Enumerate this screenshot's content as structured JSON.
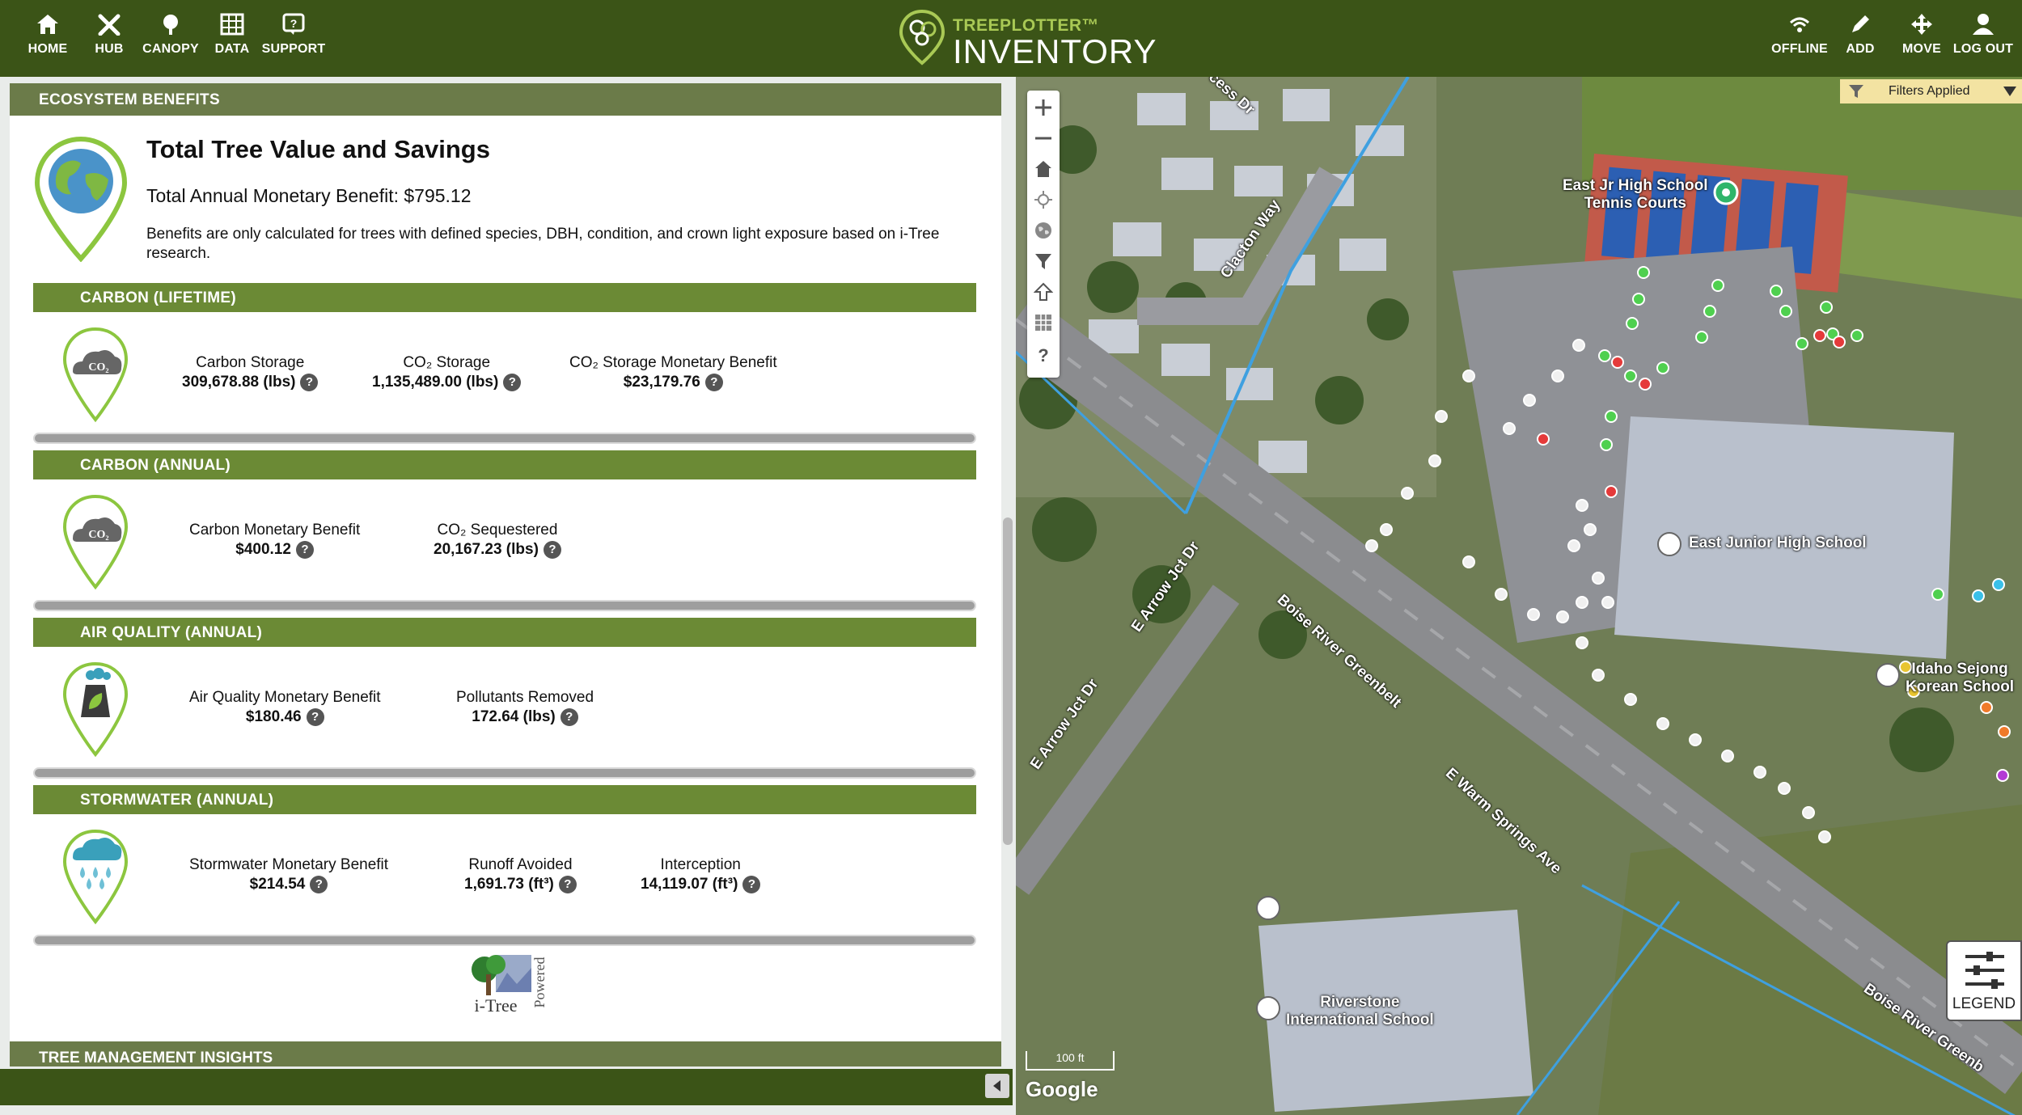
{
  "nav": {
    "home": "HOME",
    "hub": "HUB",
    "canopy": "CANOPY",
    "data": "DATA",
    "support": "SUPPORT",
    "offline": "OFFLINE",
    "add": "ADD",
    "move": "MOVE",
    "logout": "LOG OUT"
  },
  "logo": {
    "small": "TREEPLOTTER™",
    "big": "INVENTORY"
  },
  "panel": {
    "section_title": "ECOSYSTEM BENEFITS",
    "totals": {
      "title": "Total Tree Value and Savings",
      "annual": "Total Annual Monetary Benefit: $795.12",
      "note": "Benefits are only calculated for trees with defined species, DBH, condition, and crown light exposure based on i-Tree research."
    },
    "carbon_lifetime": {
      "title": "CARBON (LIFETIME)",
      "metrics": [
        {
          "label": "Carbon Storage",
          "value": "309,678.88 (lbs)"
        },
        {
          "label": "CO₂ Storage",
          "value": "1,135,489.00 (lbs)"
        },
        {
          "label": "CO₂ Storage Monetary Benefit",
          "value": "$23,179.76"
        }
      ]
    },
    "carbon_annual": {
      "title": "CARBON (ANNUAL)",
      "metrics": [
        {
          "label": "Carbon Monetary Benefit",
          "value": "$400.12"
        },
        {
          "label": "CO₂ Sequestered",
          "value": "20,167.23 (lbs)"
        }
      ]
    },
    "air_quality": {
      "title": "AIR QUALITY (ANNUAL)",
      "metrics": [
        {
          "label": "Air Quality Monetary Benefit",
          "value": "$180.46"
        },
        {
          "label": "Pollutants Removed",
          "value": "172.64 (lbs)"
        }
      ]
    },
    "stormwater": {
      "title": "STORMWATER (ANNUAL)",
      "metrics": [
        {
          "label": "Stormwater Monetary Benefit",
          "value": "$214.54"
        },
        {
          "label": "Runoff Avoided",
          "value": "1,691.73 (ft³)"
        },
        {
          "label": "Interception",
          "value": "14,119.07 (ft³)"
        }
      ]
    },
    "help_glyph": "?",
    "co2_badge": "CO₂",
    "itree": {
      "name": "i-Tree",
      "powered": "Powered"
    },
    "next_section": "TREE MANAGEMENT INSIGHTS"
  },
  "map": {
    "filters": "Filters Applied",
    "legend": "LEGEND",
    "scale": "100 ft",
    "attribution": "Google",
    "labels": {
      "tennis": "East Jr High School\nTennis Courts",
      "school1": "East Junior High School",
      "school2": "Idaho Sejong\nKorean School",
      "school3": "Riverstone\nInternational School",
      "road1": "Boise River Greenbelt",
      "road2": "E Warm Springs Ave",
      "road3": "E Arrow Jct Dr",
      "road4": "E Arrow Jct Dr",
      "road5": "Clacton Way",
      "road6": "Boise River Greenb",
      "road7": "cess Dr"
    }
  },
  "colors": {
    "topbar": "#3b5417",
    "section_header": "#6b7b49",
    "sub_header": "#6b8a35",
    "pin_green": "#8cc63f",
    "filters_bg": "#f3e3a2"
  }
}
